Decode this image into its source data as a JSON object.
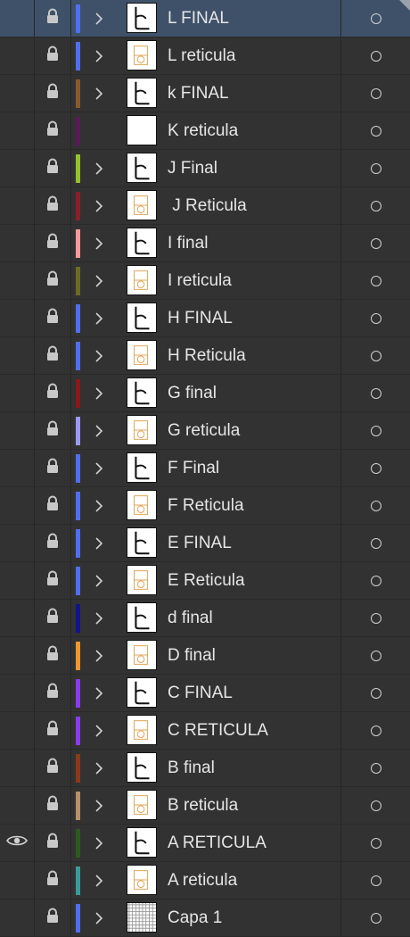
{
  "layers": [
    {
      "name": "L FINAL",
      "color": "#4f6ff0",
      "expandable": true,
      "thumb": "final",
      "selected": true,
      "visible": false
    },
    {
      "name": "L reticula",
      "color": "#4f6ff0",
      "expandable": true,
      "thumb": "grid"
    },
    {
      "name": "k FINAL",
      "color": "#8a5a2b",
      "expandable": true,
      "thumb": "final"
    },
    {
      "name": "K reticula",
      "color": "#5a1a5a",
      "expandable": false,
      "thumb": "blank"
    },
    {
      "name": "J Final",
      "color": "#93c12e",
      "expandable": true,
      "thumb": "final"
    },
    {
      "name": " J Reticula",
      "color": "#8a1f2a",
      "expandable": true,
      "thumb": "grid"
    },
    {
      "name": "I final",
      "color": "#f19a9a",
      "expandable": true,
      "thumb": "final"
    },
    {
      "name": "I reticula",
      "color": "#6b6b24",
      "expandable": true,
      "thumb": "grid"
    },
    {
      "name": "H FINAL",
      "color": "#4f6ff0",
      "expandable": true,
      "thumb": "final"
    },
    {
      "name": "H Reticula",
      "color": "#4f6ff0",
      "expandable": true,
      "thumb": "grid"
    },
    {
      "name": "G final",
      "color": "#8a1a1a",
      "expandable": true,
      "thumb": "final"
    },
    {
      "name": "G reticula",
      "color": "#9a9af0",
      "expandable": true,
      "thumb": "grid"
    },
    {
      "name": "F Final",
      "color": "#4f6ff0",
      "expandable": true,
      "thumb": "final"
    },
    {
      "name": "F Reticula",
      "color": "#4f6ff0",
      "expandable": true,
      "thumb": "grid"
    },
    {
      "name": "E FINAL",
      "color": "#4f6ff0",
      "expandable": true,
      "thumb": "final"
    },
    {
      "name": "E Reticula",
      "color": "#4f6ff0",
      "expandable": true,
      "thumb": "grid"
    },
    {
      "name": "d final",
      "color": "#12128a",
      "expandable": true,
      "thumb": "final"
    },
    {
      "name": "D final",
      "color": "#f0962e",
      "expandable": true,
      "thumb": "grid"
    },
    {
      "name": "C FINAL",
      "color": "#8a3af0",
      "expandable": true,
      "thumb": "final"
    },
    {
      "name": "C RETICULA",
      "color": "#8a3af0",
      "expandable": true,
      "thumb": "grid"
    },
    {
      "name": "B final",
      "color": "#8a3a1a",
      "expandable": true,
      "thumb": "final"
    },
    {
      "name": "B reticula",
      "color": "#b89064",
      "expandable": true,
      "thumb": "grid"
    },
    {
      "name": "A RETICULA",
      "color": "#2f5a1f",
      "expandable": true,
      "thumb": "final",
      "visible": true
    },
    {
      "name": "A reticula",
      "color": "#3a9a9a",
      "expandable": true,
      "thumb": "grid"
    },
    {
      "name": "Capa 1",
      "color": "#4f6ff0",
      "expandable": true,
      "thumb": "pattern"
    }
  ]
}
